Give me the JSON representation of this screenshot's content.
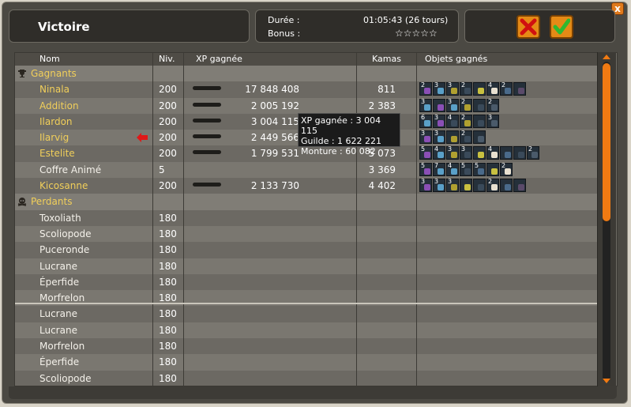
{
  "window": {
    "title": "Victoire"
  },
  "info": {
    "duration_label": "Durée :",
    "duration_value": "01:05:43 (26 tours)",
    "bonus_label": "Bonus :",
    "bonus_stars": "☆☆☆☆☆"
  },
  "buttons": {
    "close_x": "x"
  },
  "columns": {
    "name": "Nom",
    "level": "Niv.",
    "xp": "XP gagnée",
    "kamas": "Kamas",
    "items": "Objets gagnés"
  },
  "sections": {
    "winners": "Gagnants",
    "losers": "Perdants"
  },
  "winners": [
    {
      "name": "Ninala",
      "level": "200",
      "xp": "17 848 408",
      "xp_bar": true,
      "kamas": "811",
      "items": [
        {
          "q": "2",
          "c": "#8a4fb5"
        },
        {
          "q": "3",
          "c": "#5aa0c8"
        },
        {
          "q": "3",
          "c": "#b0a030"
        },
        {
          "q": "2",
          "c": "#3a4a5a"
        },
        {
          "q": "",
          "c": "#c8c040"
        },
        {
          "q": "4",
          "c": "#e8e0d0"
        },
        {
          "q": "2",
          "c": "#4a6a8a"
        },
        {
          "q": "",
          "c": "#5a4a6a"
        }
      ]
    },
    {
      "name": "Addition",
      "level": "200",
      "xp": "2 005 192",
      "xp_bar": true,
      "kamas": "2 383",
      "items": [
        {
          "q": "3",
          "c": "#5aa0c8"
        },
        {
          "q": "",
          "c": "#8a4fb5"
        },
        {
          "q": "3",
          "c": "#5aa0c8"
        },
        {
          "q": "2",
          "c": "#b0a030"
        },
        {
          "q": "",
          "c": "#3a4a5a"
        },
        {
          "q": "2",
          "c": "#4a5a6a"
        }
      ]
    },
    {
      "name": "Ilardon",
      "level": "200",
      "xp": "3 004 115",
      "xp_bar": true,
      "kamas": "",
      "items": [
        {
          "q": "6",
          "c": "#5aa0c8"
        },
        {
          "q": "3",
          "c": "#8a4fb5"
        },
        {
          "q": "4",
          "c": "#3a4a5a"
        },
        {
          "q": "2",
          "c": "#b0a030"
        },
        {
          "q": "",
          "c": "#3a4a5a"
        },
        {
          "q": "3",
          "c": "#4a5a6a"
        }
      ]
    },
    {
      "name": "Ilarvig",
      "level": "200",
      "xp": "2 449 566",
      "xp_bar": true,
      "kamas": "",
      "arrow": true,
      "items": [
        {
          "q": "3",
          "c": "#8a4fb5"
        },
        {
          "q": "3",
          "c": "#5aa0c8"
        },
        {
          "q": "",
          "c": "#b0a030"
        },
        {
          "q": "2",
          "c": "#3a4a5a"
        },
        {
          "q": "",
          "c": "#4a5a6a"
        }
      ]
    },
    {
      "name": "Estelite",
      "level": "200",
      "xp": "1 799 531",
      "xp_bar": true,
      "kamas": "5 073",
      "items": [
        {
          "q": "5",
          "c": "#8a4fb5"
        },
        {
          "q": "4",
          "c": "#5aa0c8"
        },
        {
          "q": "3",
          "c": "#b0a030"
        },
        {
          "q": "3",
          "c": "#3a4a5a"
        },
        {
          "q": "",
          "c": "#c8c040"
        },
        {
          "q": "4",
          "c": "#e8e0d0"
        },
        {
          "q": "",
          "c": "#4a6a8a"
        },
        {
          "q": "",
          "c": "#3a4a5a"
        },
        {
          "q": "2",
          "c": "#4a5a6a"
        }
      ]
    },
    {
      "name": "Coffre Animé",
      "level": "5",
      "xp": "",
      "xp_bar": false,
      "kamas": "3 369",
      "npc": true,
      "items": [
        {
          "q": "5",
          "c": "#8a4fb5"
        },
        {
          "q": "7",
          "c": "#5aa0c8"
        },
        {
          "q": "4",
          "c": "#5aa0c8"
        },
        {
          "q": "5",
          "c": "#3a4a5a"
        },
        {
          "q": "5",
          "c": "#4a6a8a"
        },
        {
          "q": "",
          "c": "#c8c040"
        },
        {
          "q": "2",
          "c": "#e8e0d0"
        }
      ]
    },
    {
      "name": "Kicosanne",
      "level": "200",
      "xp": "2 133 730",
      "xp_bar": true,
      "kamas": "4 402",
      "items": [
        {
          "q": "3",
          "c": "#8a4fb5"
        },
        {
          "q": "3",
          "c": "#5aa0c8"
        },
        {
          "q": "3",
          "c": "#b0a030"
        },
        {
          "q": "",
          "c": "#c8c040"
        },
        {
          "q": "",
          "c": "#3a4a5a"
        },
        {
          "q": "2",
          "c": "#e8e0d0"
        },
        {
          "q": "",
          "c": "#4a6a8a"
        },
        {
          "q": "",
          "c": "#5a4a6a"
        }
      ]
    }
  ],
  "losers": [
    {
      "name": "Toxoliath",
      "level": "180"
    },
    {
      "name": "Scoliopode",
      "level": "180"
    },
    {
      "name": "Puceronde",
      "level": "180"
    },
    {
      "name": "Lucrane",
      "level": "180"
    },
    {
      "name": "Éperfide",
      "level": "180"
    },
    {
      "name": "Morfrelon",
      "level": "180"
    },
    {
      "name": "Lucrane",
      "level": "180"
    },
    {
      "name": "Lucrane",
      "level": "180"
    },
    {
      "name": "Morfrelon",
      "level": "180"
    },
    {
      "name": "Éperfide",
      "level": "180"
    },
    {
      "name": "Scoliopode",
      "level": "180"
    }
  ],
  "tooltip": {
    "line1": "XP gagnée : 3 004 115",
    "line2": "Guilde : 1 622 221",
    "line3": "Monture : 60 082"
  },
  "colors": {
    "winner_name": "#f1cf5a",
    "accent": "#f07a12"
  }
}
